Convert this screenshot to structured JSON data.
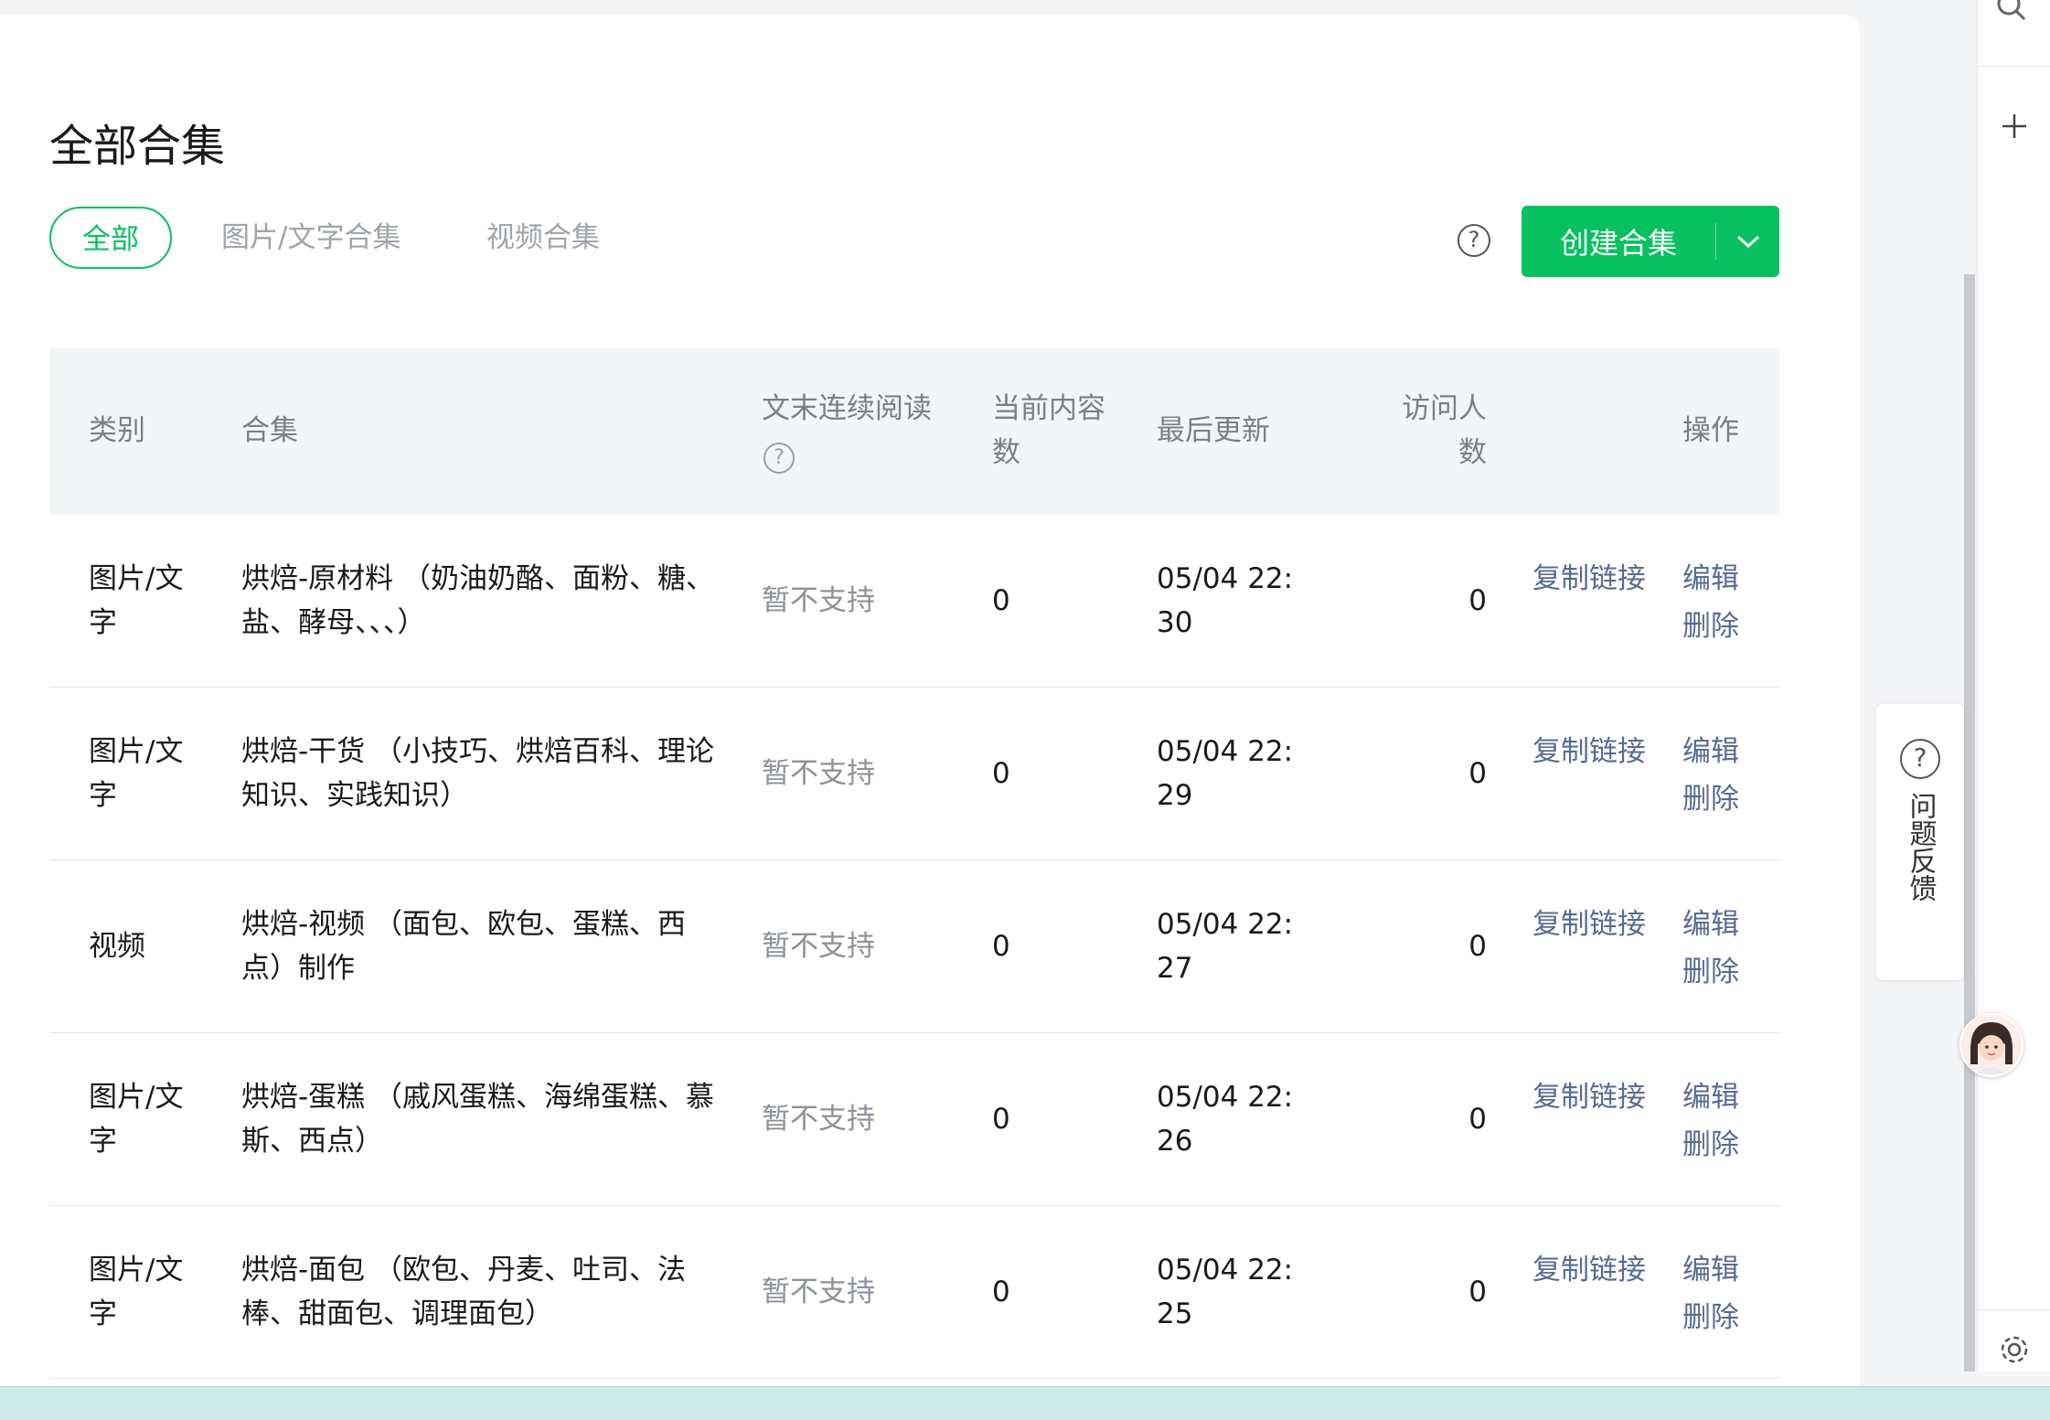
{
  "page": {
    "title": "全部合集",
    "tabs": [
      {
        "label": "全部",
        "active": true
      },
      {
        "label": "图片/文字合集",
        "active": false
      },
      {
        "label": "视频合集",
        "active": false
      }
    ],
    "help_icon": "?",
    "create_button": "创建合集"
  },
  "table": {
    "headers": {
      "category": "类别",
      "collection": "合集",
      "continuous_line1": "文末连续阅读",
      "continuous_help": "?",
      "count_line1": "当前内容",
      "count_line2": "数",
      "updated": "最后更新",
      "visitors_line1": "访问人",
      "visitors_line2": "数",
      "actions": "操作"
    },
    "rows": [
      {
        "cat1": "图片/文",
        "cat2": "字",
        "name1": "烘焙-原材料 （奶油奶酪、面粉、糖、",
        "name2": "盐、酵母、、、）",
        "continuous": "暂不支持",
        "count": "0",
        "date1": "05/04 22:",
        "date2": "30",
        "visitors": "0",
        "copy": "复制链接",
        "edit": "编辑",
        "delete": "删除"
      },
      {
        "cat1": "图片/文",
        "cat2": "字",
        "name1": "烘焙-干货 （小技巧、烘焙百科、理论",
        "name2": "知识、实践知识）",
        "continuous": "暂不支持",
        "count": "0",
        "date1": "05/04 22:",
        "date2": "29",
        "visitors": "0",
        "copy": "复制链接",
        "edit": "编辑",
        "delete": "删除"
      },
      {
        "cat1": "视频",
        "cat2": "",
        "name1": "烘焙-视频 （面包、欧包、蛋糕、西",
        "name2": "点）制作",
        "continuous": "暂不支持",
        "count": "0",
        "date1": "05/04 22:",
        "date2": "27",
        "visitors": "0",
        "copy": "复制链接",
        "edit": "编辑",
        "delete": "删除"
      },
      {
        "cat1": "图片/文",
        "cat2": "字",
        "name1": "烘焙-蛋糕 （戚风蛋糕、海绵蛋糕、慕",
        "name2": "斯、西点）",
        "continuous": "暂不支持",
        "count": "0",
        "date1": "05/04 22:",
        "date2": "26",
        "visitors": "0",
        "copy": "复制链接",
        "edit": "编辑",
        "delete": "删除"
      },
      {
        "cat1": "图片/文",
        "cat2": "字",
        "name1": "烘焙-面包 （欧包、丹麦、吐司、法",
        "name2": "棒、甜面包、调理面包）",
        "continuous": "暂不支持",
        "count": "0",
        "date1": "05/04 22:",
        "date2": "25",
        "visitors": "0",
        "copy": "复制链接",
        "edit": "编辑",
        "delete": "删除"
      }
    ]
  },
  "feedback": {
    "icon": "?",
    "label": "问题反馈"
  },
  "colors": {
    "accent": "#07c160",
    "link": "#576b95",
    "muted": "#8d9199"
  },
  "icons": [
    "search-icon",
    "plus-icon",
    "settings-icon",
    "chevron-down-icon",
    "question-icon",
    "avatar"
  ]
}
